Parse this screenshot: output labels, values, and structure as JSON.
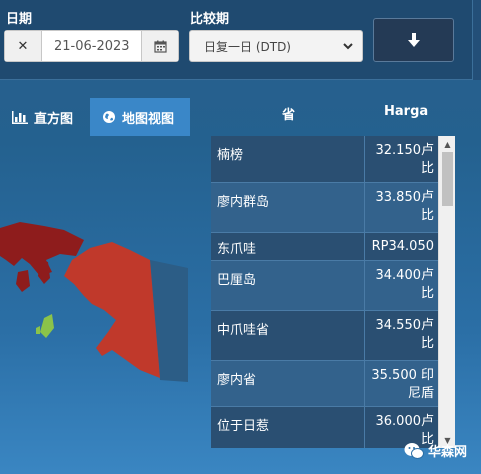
{
  "filters": {
    "date_label": "日期",
    "date_value": "21-06-2023",
    "compare_label": "比较期",
    "compare_value": "日复一日 (DTD)"
  },
  "views": {
    "bar_label": "直方图",
    "map_label": "地图视图"
  },
  "table": {
    "col_province": "省",
    "col_price": "Harga",
    "rows": [
      {
        "province": "楠榜",
        "price_line1": "32.150卢",
        "price_line2": "比"
      },
      {
        "province": "廖内群岛",
        "price_line1": "33.850卢",
        "price_line2": "比"
      },
      {
        "province": "东爪哇",
        "price_line1": "RP34.050",
        "price_line2": ""
      },
      {
        "province": "巴厘岛",
        "price_line1": "34.400卢",
        "price_line2": "比"
      },
      {
        "province": "中爪哇省",
        "price_line1": "34.550卢",
        "price_line2": "比"
      },
      {
        "province": "廖内省",
        "price_line1": "35.500 印",
        "price_line2": "尼盾"
      },
      {
        "province": "位于日惹",
        "price_line1": "36.000卢",
        "price_line2": "比"
      }
    ]
  },
  "watermark": {
    "text": "华森网"
  },
  "colors": {
    "map_red": "#c0392b",
    "map_dark_red": "#8e1c1c",
    "map_green": "#8bc34a",
    "active_view": "#3a87c8"
  }
}
